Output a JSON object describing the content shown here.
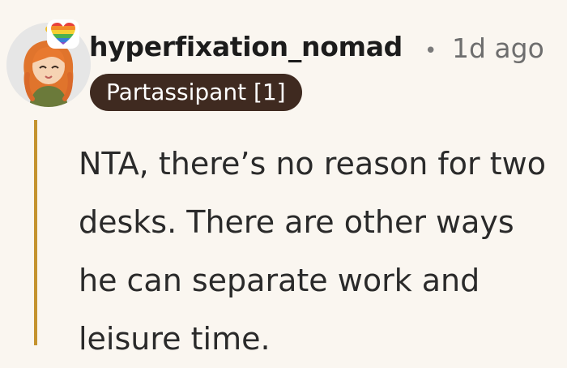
{
  "comment": {
    "username": "hyperfixation_nomad",
    "separator": "•",
    "timestamp": "1d ago",
    "flair": "Partassipant [1]",
    "body": "NTA, there’s no reason for two desks. There are other ways he can separate work and leisure time."
  },
  "icons": {
    "avatar": "avatar-illustration",
    "badge": "rainbow-heart-icon"
  },
  "colors": {
    "background": "#faf6f0",
    "flair_bg": "#3f2a20",
    "thread_line": "#c4932e",
    "username": "#1c1c1c",
    "timestamp": "#6e6e6e",
    "body_text": "#2a2a2a"
  }
}
